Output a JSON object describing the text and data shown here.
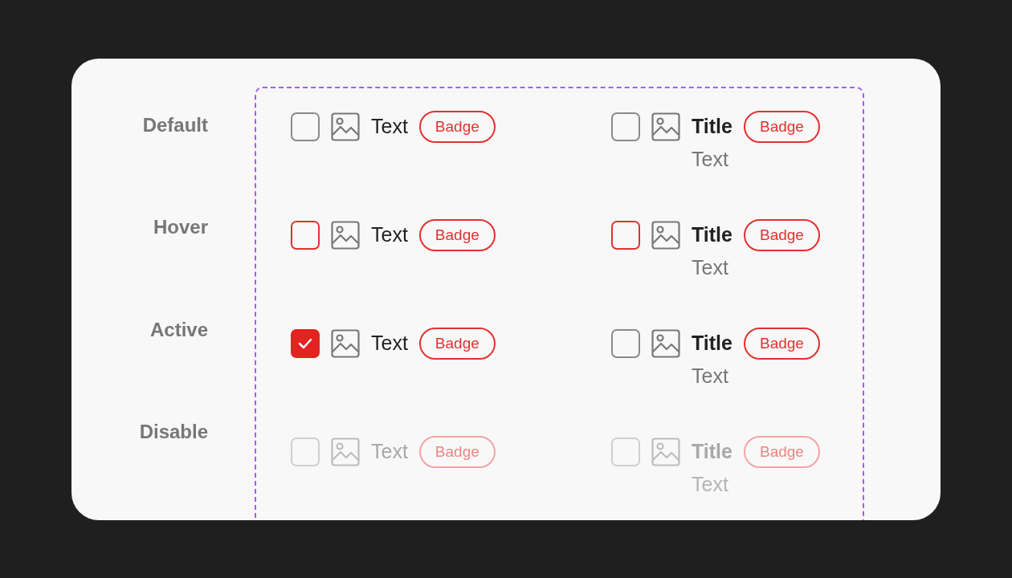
{
  "rows": [
    {
      "label": "Default",
      "kind": "default",
      "items": [
        {
          "kind": "single",
          "text": "Text",
          "badge": "Badge",
          "checked": false
        },
        {
          "kind": "double",
          "title": "Title",
          "text": "Text",
          "badge": "Badge",
          "checked": false
        }
      ]
    },
    {
      "label": "Hover",
      "kind": "hover",
      "items": [
        {
          "kind": "single",
          "text": "Text",
          "badge": "Badge",
          "checked": false
        },
        {
          "kind": "double",
          "title": "Title",
          "text": "Text",
          "badge": "Badge",
          "checked": false
        }
      ]
    },
    {
      "label": "Active",
      "kind": "active",
      "items": [
        {
          "kind": "single",
          "text": "Text",
          "badge": "Badge",
          "checked": true
        },
        {
          "kind": "double",
          "title": "Title",
          "text": "Text",
          "badge": "Badge",
          "checked": false
        }
      ]
    },
    {
      "label": "Disable",
      "kind": "disabled",
      "items": [
        {
          "kind": "single",
          "text": "Text",
          "badge": "Badge",
          "checked": false
        },
        {
          "kind": "double",
          "title": "Title",
          "text": "Text",
          "badge": "Badge",
          "checked": false
        }
      ]
    }
  ]
}
